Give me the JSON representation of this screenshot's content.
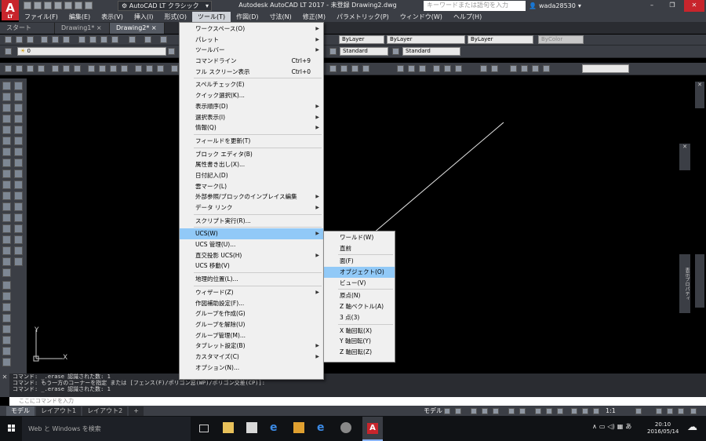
{
  "title": {
    "logo": "A",
    "logo_sub": "LT",
    "workspace": "AutoCAD LT クラシック",
    "app_title": "Autodesk AutoCAD LT 2017 - 未登録   Drawing2.dwg",
    "search_placeholder": "キーワードまたは語句を入力",
    "user": "wada28530",
    "win_min": "–",
    "win_max": "❐",
    "win_close": "✕"
  },
  "menubar": [
    {
      "label": "ファイル(F)"
    },
    {
      "label": "編集(E)"
    },
    {
      "label": "表示(V)"
    },
    {
      "label": "挿入(I)"
    },
    {
      "label": "形式(O)"
    },
    {
      "label": "ツール(T)"
    },
    {
      "label": "作図(D)"
    },
    {
      "label": "寸法(N)"
    },
    {
      "label": "修正(M)"
    },
    {
      "label": "パラメトリック(P)"
    },
    {
      "label": "ウィンドウ(W)"
    },
    {
      "label": "ヘルプ(H)"
    }
  ],
  "tabs": [
    {
      "label": "スタート"
    },
    {
      "label": "Drawing1*",
      "close": "×"
    },
    {
      "label": "Drawing2*",
      "close": "×"
    }
  ],
  "toolbars": {
    "layer_dd": "0",
    "standard_dd1": "Standard",
    "standard_dd2": "Standard",
    "bylayer1": "ByLayer",
    "bylayer2": "ByLayer",
    "bylayer3": "ByLayer",
    "bycolor": "ByColor"
  },
  "tools_menu": [
    {
      "label": "ワークスペース(O)",
      "arrow": "▶"
    },
    {
      "label": "パレット",
      "arrow": "▶"
    },
    {
      "label": "ツールバー",
      "arrow": "▶"
    },
    {
      "label": "コマンドライン",
      "shortcut": "Ctrl+9"
    },
    {
      "label": "フル スクリーン表示",
      "shortcut": "Ctrl+0"
    },
    {
      "sep": true
    },
    {
      "label": "スペルチェック(E)"
    },
    {
      "label": "クイック選択(K)..."
    },
    {
      "label": "表示順序(D)",
      "arrow": "▶"
    },
    {
      "label": "選択表示(I)",
      "arrow": "▶"
    },
    {
      "label": "情報(Q)",
      "arrow": "▶"
    },
    {
      "sep": true
    },
    {
      "label": "フィールドを更新(T)"
    },
    {
      "sep": true
    },
    {
      "label": "ブロック エディタ(B)"
    },
    {
      "label": "属性書き出し(X)..."
    },
    {
      "label": "日付記入(D)"
    },
    {
      "label": "雲マーク(L)"
    },
    {
      "label": "外部参照/ブロックのインプレイス編集",
      "arrow": "▶"
    },
    {
      "label": "データ リンク",
      "arrow": "▶"
    },
    {
      "sep": true
    },
    {
      "label": "スクリプト実行(R)..."
    },
    {
      "sep": true
    },
    {
      "label": "UCS(W)",
      "arrow": "▶",
      "highlight": true
    },
    {
      "label": "UCS 管理(U)..."
    },
    {
      "label": "直交投影 UCS(H)",
      "arrow": "▶"
    },
    {
      "label": "UCS 移動(V)"
    },
    {
      "sep": true
    },
    {
      "label": "地理的位置(L)..."
    },
    {
      "sep": true
    },
    {
      "label": "ウィザード(Z)",
      "arrow": "▶"
    },
    {
      "label": "作図補助設定(F)..."
    },
    {
      "label": "グループを作成(G)"
    },
    {
      "label": "グループを解除(U)"
    },
    {
      "label": "グループ管理(M)..."
    },
    {
      "label": "タブレット設定(B)",
      "arrow": "▶"
    },
    {
      "label": "カスタマイズ(C)",
      "arrow": "▶"
    },
    {
      "label": "オプション(N)..."
    }
  ],
  "ucs_menu": [
    {
      "label": "ワールド(W)"
    },
    {
      "label": "直前"
    },
    {
      "sep": true
    },
    {
      "label": "面(F)"
    },
    {
      "label": "オブジェクト(O)",
      "highlight": true
    },
    {
      "label": "ビュー(V)"
    },
    {
      "sep": true
    },
    {
      "label": "原点(N)"
    },
    {
      "label": "Z 軸ベクトル(A)"
    },
    {
      "label": "3 点(3)"
    },
    {
      "sep": true
    },
    {
      "label": "X 軸回転(X)"
    },
    {
      "label": "Y 軸回転(Y)"
    },
    {
      "label": "Z 軸回転(Z)"
    }
  ],
  "canvas": {
    "ucs_y": "Y",
    "ucs_x": "X",
    "panel_close1": "✕",
    "panel_close2": "✕",
    "properties_label": "表示プロパティ"
  },
  "command": {
    "history": [
      "コマンド:  _.erase 認識された数: 1",
      "コマンド: もう一方のコーナーを指定 または [フェンス(F)/ポリゴン窓(WP)/ポリゴン交差(CP)]:",
      "コマンド:  _.erase 認識された数: 1"
    ],
    "input_placeholder": "ここにコマンドを入力"
  },
  "layout_tabs": [
    {
      "label": "モデル"
    },
    {
      "label": "レイアウト1"
    },
    {
      "label": "レイアウト2"
    },
    {
      "label": "+"
    }
  ],
  "status": {
    "model": "モデル",
    "scale": "1:1"
  },
  "taskbar": {
    "search_placeholder": "Web と Windows を検索",
    "ime": "あ",
    "time": "20:10",
    "date": "2016/05/14"
  },
  "colors": {
    "accent_red": "#c8252c",
    "highlight_blue": "#91c9f7"
  }
}
